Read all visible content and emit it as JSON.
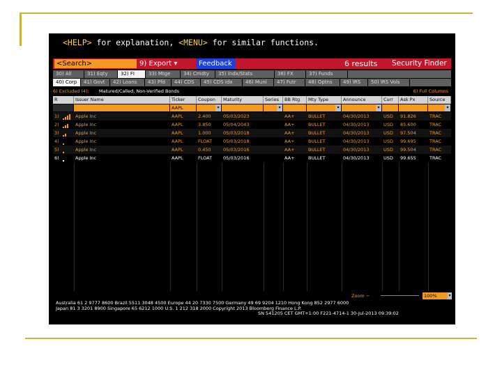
{
  "help_line": {
    "help_key": "<HELP>",
    "text1": " for explanation, ",
    "menu_key": "<MENU>",
    "text2": " for similar functions."
  },
  "toolbar": {
    "search_placeholder": "<Search>",
    "export_label": "9) Export ▾",
    "feedback_label": "Feedback",
    "results_count": "6 results",
    "app_title": "Security Finder"
  },
  "asset_tabs": [
    "30) All",
    "31) Eqty",
    "32) FI",
    "33) Mtge",
    "34) Cmdty",
    "35) Indx/Stats",
    "36) FX",
    "37) Funds"
  ],
  "fi_tabs": [
    "40) Corp",
    "41) Govt",
    "42) Loans",
    "43) Pfd",
    "44) CDS",
    "45) CDS Idx",
    "46) Muni",
    "47) Futr",
    "48) Optns",
    "49) IRS",
    "50) IRS Vols"
  ],
  "excluded": {
    "label": "6) Excluded (4):",
    "text": "Matured/Called, Non-Verified Bonds",
    "full_columns": "6) Full Columns"
  },
  "table": {
    "columns": [
      "R",
      "Issuer Name",
      "Ticker",
      "Coupon",
      "Maturity",
      "Series",
      "BB Rtg",
      "Mty Type",
      "Announce",
      "Curr",
      "Ask Px",
      "Source"
    ],
    "filter_ticker": "AAPL",
    "rows": [
      {
        "num": "1)",
        "issuer": "Apple Inc",
        "ticker": "AAPL",
        "coupon": "2.400",
        "maturity": "05/03/2023",
        "series": "",
        "rtg": "AA+",
        "mty": "BULLET",
        "announce": "04/30/2013",
        "curr": "USD",
        "ask": "91.826",
        "source": "TRAC",
        "bars": 4
      },
      {
        "num": "2)",
        "issuer": "Apple Inc",
        "ticker": "AAPL",
        "coupon": "3.850",
        "maturity": "05/04/2043",
        "series": "",
        "rtg": "AA+",
        "mty": "BULLET",
        "announce": "04/30/2013",
        "curr": "USD",
        "ask": "85.600",
        "source": "TRAC",
        "bars": 3
      },
      {
        "num": "3)",
        "issuer": "Apple Inc",
        "ticker": "AAPL",
        "coupon": "1.000",
        "maturity": "05/03/2018",
        "series": "",
        "rtg": "AA+",
        "mty": "BULLET",
        "announce": "04/30/2013",
        "curr": "USD",
        "ask": "97.504",
        "source": "TRAC",
        "bars": 2
      },
      {
        "num": "4)",
        "issuer": "Apple Inc",
        "ticker": "AAPL",
        "coupon": "FLOAT",
        "maturity": "05/03/2018",
        "series": "",
        "rtg": "AA+",
        "mty": "BULLET",
        "announce": "04/30/2013",
        "curr": "USD",
        "ask": "99.695",
        "source": "TRAC",
        "bars": 1
      },
      {
        "num": "5)",
        "issuer": "Apple Inc",
        "ticker": "AAPL",
        "coupon": "0.450",
        "maturity": "05/03/2016",
        "series": "",
        "rtg": "AA+",
        "mty": "BULLET",
        "announce": "04/30/2013",
        "curr": "USD",
        "ask": "99.504",
        "source": "TRAC",
        "bars": 1
      },
      {
        "num": "6)",
        "issuer": "Apple Inc",
        "ticker": "AAPL",
        "coupon": "FLOAT",
        "maturity": "05/03/2016",
        "series": "",
        "rtg": "AA+",
        "mty": "BULLET",
        "announce": "04/30/2013",
        "curr": "USD",
        "ask": "99.655",
        "source": "TRAC",
        "bars": 1
      }
    ]
  },
  "zoom": {
    "label": "Zoom",
    "minus": "−",
    "value": "100%"
  },
  "footer": {
    "line1": "Australia 61 2 9777 8600 Brazil 5511 3048 4500 Europe 44 20 7330 7500 Germany 49 69 9204 1210 Hong Kong 852 2977 6000",
    "line2": "Japan 81 3 3201 8900        Singapore 65 6212 1000        U.S. 1 212 318 2000        Copyright 2013 Bloomberg Finance L.P.",
    "line3": "SN 541205 CET  GMT+1:00 F221-4714-1 30-Jul-2013 09:39:02"
  },
  "colors": {
    "amber": "#f29a1f",
    "red_bar": "#c3162d",
    "blue": "#1e3fd8"
  }
}
